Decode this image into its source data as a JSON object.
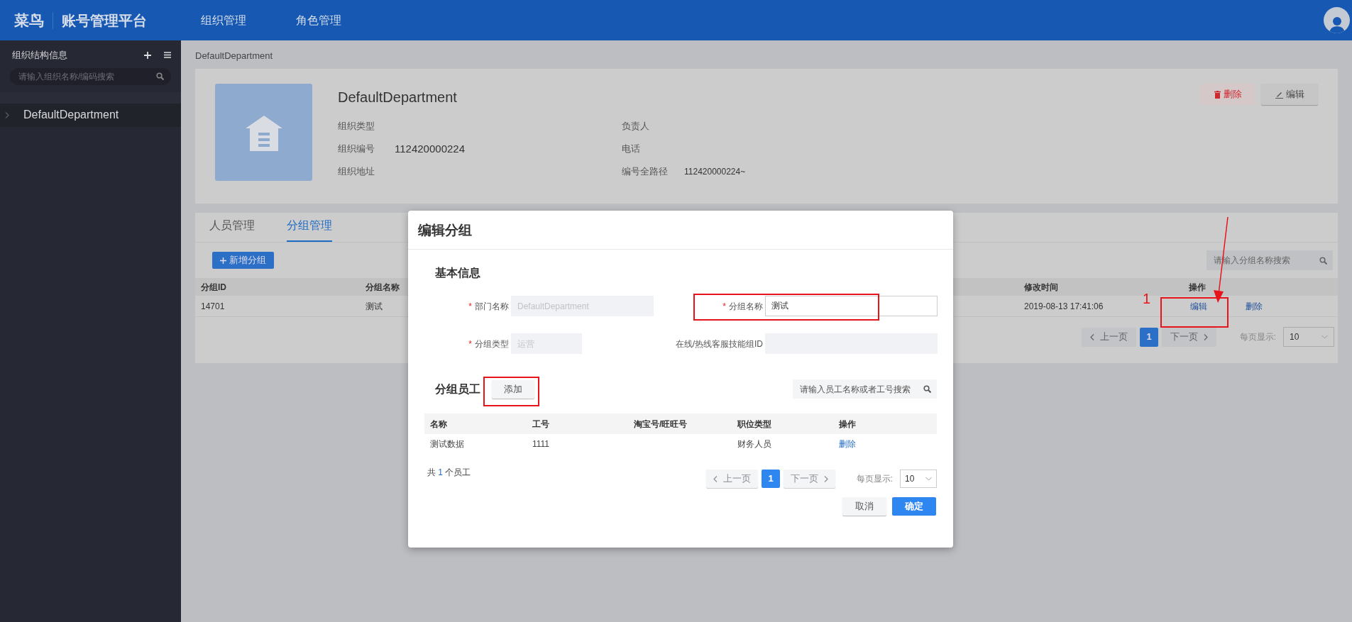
{
  "header": {
    "logo": "菜鸟",
    "title": "账号管理平台",
    "nav": [
      {
        "label": "组织管理",
        "selected": false
      },
      {
        "label": "角色管理",
        "selected": false
      }
    ]
  },
  "sidebar": {
    "title": "组织结构信息",
    "search": {
      "placeholder": "请输入组织名称/编码搜索"
    },
    "tree": [
      {
        "label": "DefaultDepartment",
        "expanded": false
      }
    ]
  },
  "breadcrumb": "DefaultDepartment",
  "org_card": {
    "name": "DefaultDepartment",
    "fields_left": [
      {
        "label": "组织类型"
      },
      {
        "label": "组织编号",
        "value": "112420000224"
      },
      {
        "label": "组织地址"
      }
    ],
    "fields_right": [
      {
        "label": "负责人"
      },
      {
        "label": "电话"
      },
      {
        "label": "编号全路径",
        "value": "112420000224~"
      }
    ],
    "buttons": [
      {
        "label": "删除",
        "kind": "danger"
      },
      {
        "label": "编辑",
        "kind": "default"
      }
    ]
  },
  "tabs": [
    {
      "label": "人员管理",
      "selected": false
    },
    {
      "label": "分组管理",
      "selected": true
    }
  ],
  "group_panel": {
    "add_button": "新增分组",
    "search": {
      "placeholder": "请输入分组名称搜索"
    },
    "columns": [
      {
        "label": "分组ID"
      },
      {
        "label": "分组名称"
      },
      {
        "label": "修改时间"
      },
      {
        "label": "操作"
      }
    ],
    "rows": [
      {
        "id": "14701",
        "name": "测试",
        "modified": "2019-08-13 17:41:06",
        "actions": [
          "编辑",
          "删除"
        ]
      }
    ],
    "pagination": {
      "prev": "上一页",
      "pages": [
        {
          "label": "1",
          "selected": true
        }
      ],
      "next": "下一页",
      "page_size_label": "每页显示:",
      "page_size": "10"
    }
  },
  "modal": {
    "title": "编辑分组",
    "section": "基本信息",
    "fields": [
      {
        "label": "部门名称",
        "required": true,
        "disabled": true,
        "value": "DefaultDepartment",
        "kind": "input"
      },
      {
        "label": "分组名称",
        "required": true,
        "disabled": false,
        "value": "测试",
        "kind": "input"
      },
      {
        "label": "分组类型",
        "required": true,
        "disabled": true,
        "value": "运营",
        "kind": "select"
      },
      {
        "label": "在线/热线客服技能组ID",
        "required": false,
        "disabled": true,
        "kind": "input"
      }
    ],
    "required_mark": "*",
    "members_title": "分组员工",
    "add_button": "添加",
    "search": {
      "placeholder": "请输入员工名称或者工号搜索"
    },
    "columns": [
      "名称",
      "工号",
      "淘宝号/旺旺号",
      "职位类型",
      "操作"
    ],
    "rows": [
      {
        "cells": [
          "测试数据",
          "1111",
          "",
          "财务人员"
        ],
        "action": "删除"
      }
    ],
    "total": {
      "prefix": "共",
      "count": "1",
      "suffix": "个员工"
    },
    "pagination": {
      "prev": "上一页",
      "pages": [
        {
          "label": "1",
          "selected": true
        }
      ],
      "next": "下一页",
      "page_size_label": "每页显示:",
      "page_size": "10"
    },
    "buttons": [
      {
        "label": "取消",
        "kind": "default"
      },
      {
        "label": "确定",
        "kind": "primary"
      }
    ]
  },
  "annotations": {
    "label": "1"
  }
}
